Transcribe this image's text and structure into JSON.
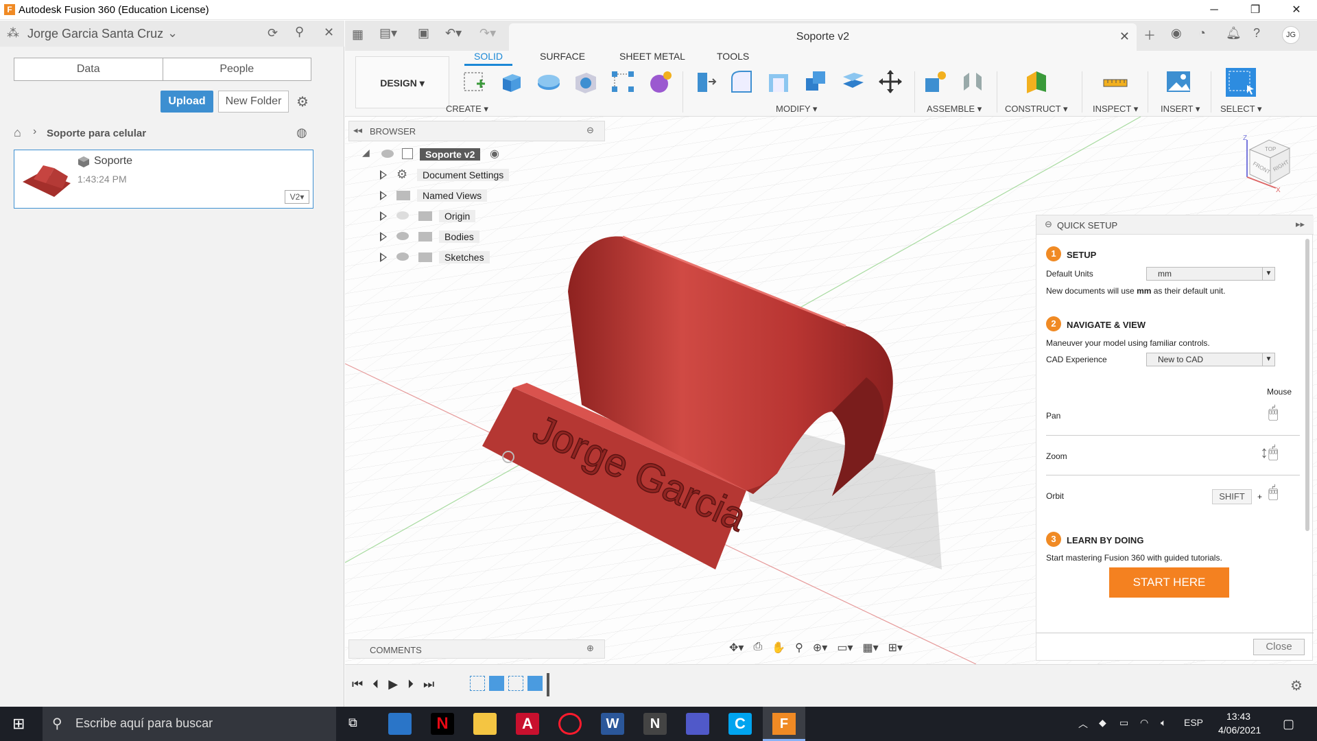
{
  "window": {
    "app_title": "Autodesk Fusion 360 (Education License)"
  },
  "data_panel": {
    "user": "Jorge Garcia Santa Cruz",
    "tabs": [
      "Data",
      "People"
    ],
    "upload_label": "Upload",
    "new_folder_label": "New Folder",
    "breadcrumb": "Soporte para celular",
    "file": {
      "name": "Soporte",
      "time": "1:43:24 PM",
      "version": "V2▾"
    }
  },
  "document": {
    "tab_title": "Soporte v2"
  },
  "toolbar": {
    "workspace": "DESIGN ▾",
    "tabs": [
      "SOLID",
      "SURFACE",
      "SHEET METAL",
      "TOOLS"
    ],
    "groups": [
      "CREATE ▾",
      "MODIFY ▾",
      "ASSEMBLE ▾",
      "CONSTRUCT ▾",
      "INSPECT ▾",
      "INSERT ▾",
      "SELECT ▾"
    ]
  },
  "browser": {
    "title": "BROWSER",
    "root": "Soporte v2",
    "items": [
      "Document Settings",
      "Named Views",
      "Origin",
      "Bodies",
      "Sketches"
    ]
  },
  "model": {
    "engraving": "Jorge Garcia",
    "color": "#c23a36"
  },
  "viewcube": {
    "faces": [
      "TOP",
      "FRONT",
      "RIGHT"
    ],
    "axes": [
      "Z",
      "X"
    ]
  },
  "quick_setup": {
    "title": "QUICK SETUP",
    "s1": {
      "num": "1",
      "title": "SETUP",
      "units_label": "Default Units",
      "units_value": "mm",
      "note_pre": "New documents will use ",
      "note_unit": "mm",
      "note_post": " as their default unit."
    },
    "s2": {
      "num": "2",
      "title": "NAVIGATE & VIEW",
      "desc": "Maneuver your model using familiar controls.",
      "cad_label": "CAD Experience",
      "cad_value": "New to CAD",
      "mouse_label": "Mouse",
      "pan": "Pan",
      "zoom": "Zoom",
      "orbit": "Orbit",
      "shift": "SHIFT",
      "plus": "+"
    },
    "s3": {
      "num": "3",
      "title": "LEARN BY DOING",
      "desc": "Start mastering Fusion 360 with guided tutorials.",
      "start": "START HERE"
    },
    "close": "Close"
  },
  "comments": {
    "title": "COMMENTS"
  },
  "taskbar": {
    "search_placeholder": "Escribe aquí para buscar",
    "lang": "ESP",
    "time": "13:43",
    "date": "4/06/2021"
  }
}
